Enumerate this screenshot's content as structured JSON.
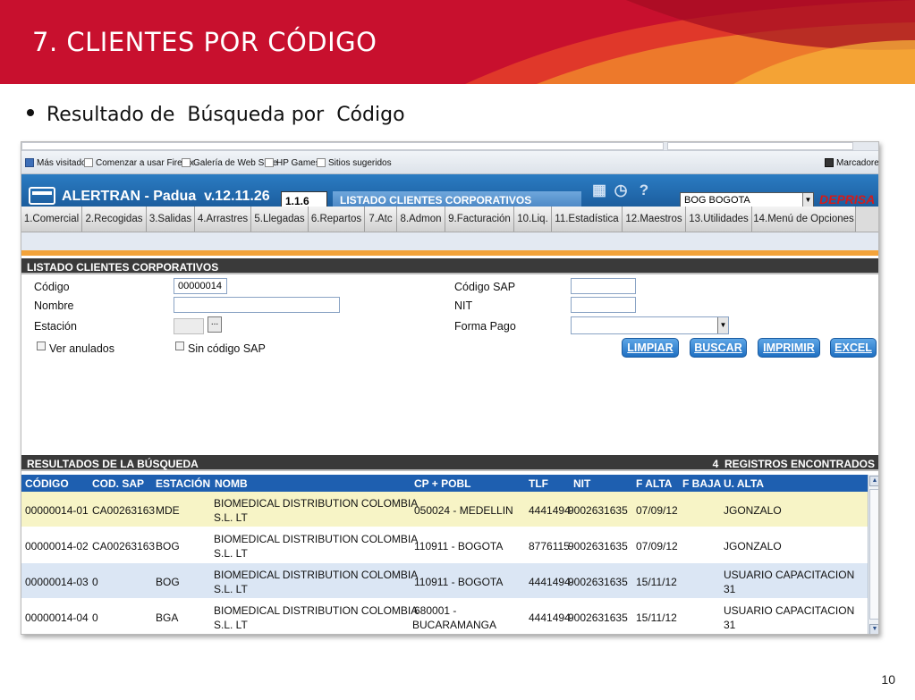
{
  "slide": {
    "title": "7. CLIENTES POR CÓDIGO",
    "bullet": "Resultado de  Búsqueda por  Código",
    "page_number": "10"
  },
  "bookmarks": [
    {
      "label": "Más visitados",
      "icon": "blue-bookmark-icon"
    },
    {
      "label": "Comenzar a usar Firefox",
      "icon": "page-icon"
    },
    {
      "label": "Galería de Web Slice",
      "icon": "page-icon"
    },
    {
      "label": "HP Games",
      "icon": "page-icon"
    },
    {
      "label": "Sitios sugeridos",
      "icon": "page-icon"
    },
    {
      "label": "Marcadores",
      "icon": "bookmarks-icon"
    }
  ],
  "app": {
    "title": "ALERTRAN - Padua  v.12.11.26",
    "version": "1.1.6",
    "screen_title": "LISTADO CLIENTES CORPORATIVOS",
    "station": "BOG BOGOTA",
    "brand": "DEPRISA",
    "icons": [
      "calendar-icon",
      "clock-icon",
      "help-icon"
    ]
  },
  "menu": [
    "1.Comercial",
    "2.Recogidas",
    "3.Salidas",
    "4.Arrastres",
    "5.Llegadas",
    "6.Repartos",
    "7.Atc",
    "8.Admon",
    "9.Facturación",
    "10.Liq.",
    "11.Estadística",
    "12.Maestros",
    "13.Utilidades",
    "14.Menú de Opciones"
  ],
  "form": {
    "header": "LISTADO CLIENTES CORPORATIVOS",
    "codigo_label": "Código",
    "codigo_value": "00000014",
    "nombre_label": "Nombre",
    "nombre_value": "",
    "estacion_label": "Estación",
    "estacion_button": "...",
    "ver_anulados_label": "Ver anulados",
    "sin_codigo_sap_label": "Sin código SAP",
    "codigo_sap_label": "Código SAP",
    "nit_label": "NIT",
    "forma_pago_label": "Forma Pago",
    "buttons": {
      "limpiar": "LIMPIAR",
      "buscar": "BUSCAR",
      "imprimir": "IMPRIMIR",
      "excel": "EXCEL"
    }
  },
  "results": {
    "header": "RESULTADOS DE LA BÚSQUEDA",
    "count": "4  REGISTROS ENCONTRADOS",
    "columns": [
      "CÓDIGO",
      "COD. SAP",
      "ESTACIÓN",
      "NOMB",
      "CP + POBL",
      "TLF",
      "NIT",
      "F ALTA",
      "F BAJA",
      "U. ALTA"
    ],
    "rows": [
      {
        "codigo": "00000014-01",
        "cod_sap": "CA00263163",
        "estacion": "MDE",
        "nomb_1": "BIOMEDICAL DISTRIBUTION COLOMBIA",
        "nomb_2": "S.L. LT",
        "cp_1": "050024 - MEDELLIN",
        "cp_2": "",
        "tlf": "4441494",
        "nit": "9002631635",
        "f_alta": "07/09/12",
        "f_baja": "",
        "u_alta_1": "JGONZALO",
        "u_alta_2": "",
        "bg": "#f7f4c6"
      },
      {
        "codigo": "00000014-02",
        "cod_sap": "CA00263163",
        "estacion": "BOG",
        "nomb_1": "BIOMEDICAL DISTRIBUTION COLOMBIA",
        "nomb_2": "S.L. LT",
        "cp_1": "110911 - BOGOTA",
        "cp_2": "",
        "tlf": "8776115",
        "nit": "9002631635",
        "f_alta": "07/09/12",
        "f_baja": "",
        "u_alta_1": "JGONZALO",
        "u_alta_2": "",
        "bg": "#ffffff"
      },
      {
        "codigo": "00000014-03",
        "cod_sap": "0",
        "estacion": "BOG",
        "nomb_1": "BIOMEDICAL DISTRIBUTION COLOMBIA",
        "nomb_2": "S.L. LT",
        "cp_1": "110911 - BOGOTA",
        "cp_2": "",
        "tlf": "4441494",
        "nit": "9002631635",
        "f_alta": "15/11/12",
        "f_baja": "",
        "u_alta_1": "USUARIO CAPACITACION",
        "u_alta_2": "31",
        "bg": "#dbe6f4"
      },
      {
        "codigo": "00000014-04",
        "cod_sap": "0",
        "estacion": "BGA",
        "nomb_1": "BIOMEDICAL DISTRIBUTION COLOMBIA",
        "nomb_2": "S.L. LT",
        "cp_1": "680001 -",
        "cp_2": "BUCARAMANGA",
        "tlf": "4441494",
        "nit": "9002631635",
        "f_alta": "15/11/12",
        "f_baja": "",
        "u_alta_1": "USUARIO CAPACITACION",
        "u_alta_2": "31",
        "bg": "#ffffff"
      }
    ]
  }
}
